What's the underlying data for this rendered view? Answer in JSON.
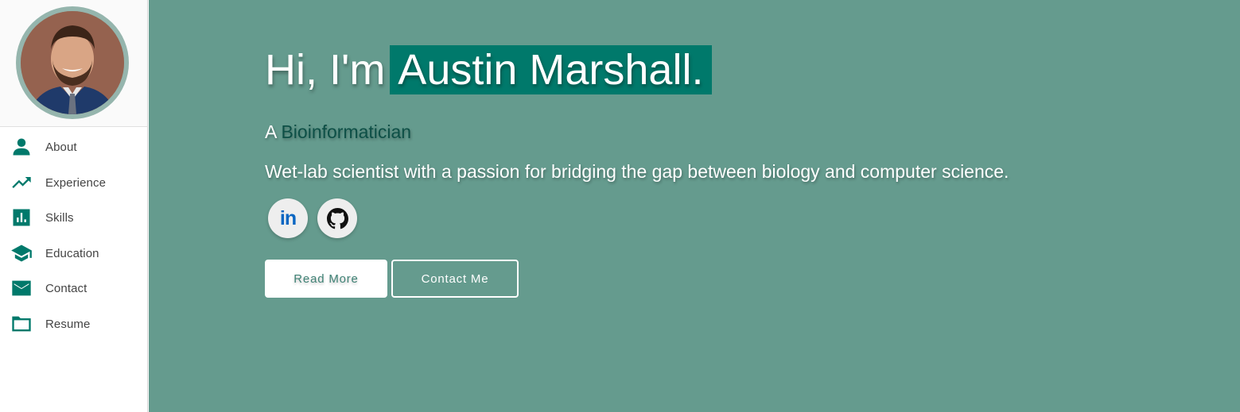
{
  "sidebar": {
    "items": [
      {
        "label": "About",
        "icon": "person-icon"
      },
      {
        "label": "Experience",
        "icon": "trending-up-icon"
      },
      {
        "label": "Skills",
        "icon": "bar-chart-icon"
      },
      {
        "label": "Education",
        "icon": "graduation-cap-icon"
      },
      {
        "label": "Contact",
        "icon": "mail-icon"
      },
      {
        "label": "Resume",
        "icon": "folder-icon"
      }
    ]
  },
  "hero": {
    "greeting_prefix": "Hi, I'm",
    "name": "Austin Marshall.",
    "role_prefix": "A",
    "role": "Bioinformatician",
    "tagline": "Wet-lab scientist with a passion for bridging the gap between biology and computer science.",
    "social": [
      {
        "label": "in",
        "icon": "linkedin-icon"
      },
      {
        "icon": "github-icon"
      }
    ],
    "buttons": {
      "read_more": "Read More",
      "contact_me": "Contact Me"
    }
  },
  "colors": {
    "accent": "#00796b",
    "hero_background": "#659b8e",
    "role_text": "#0d4f46",
    "avatar_ring": "#95b5ad"
  }
}
